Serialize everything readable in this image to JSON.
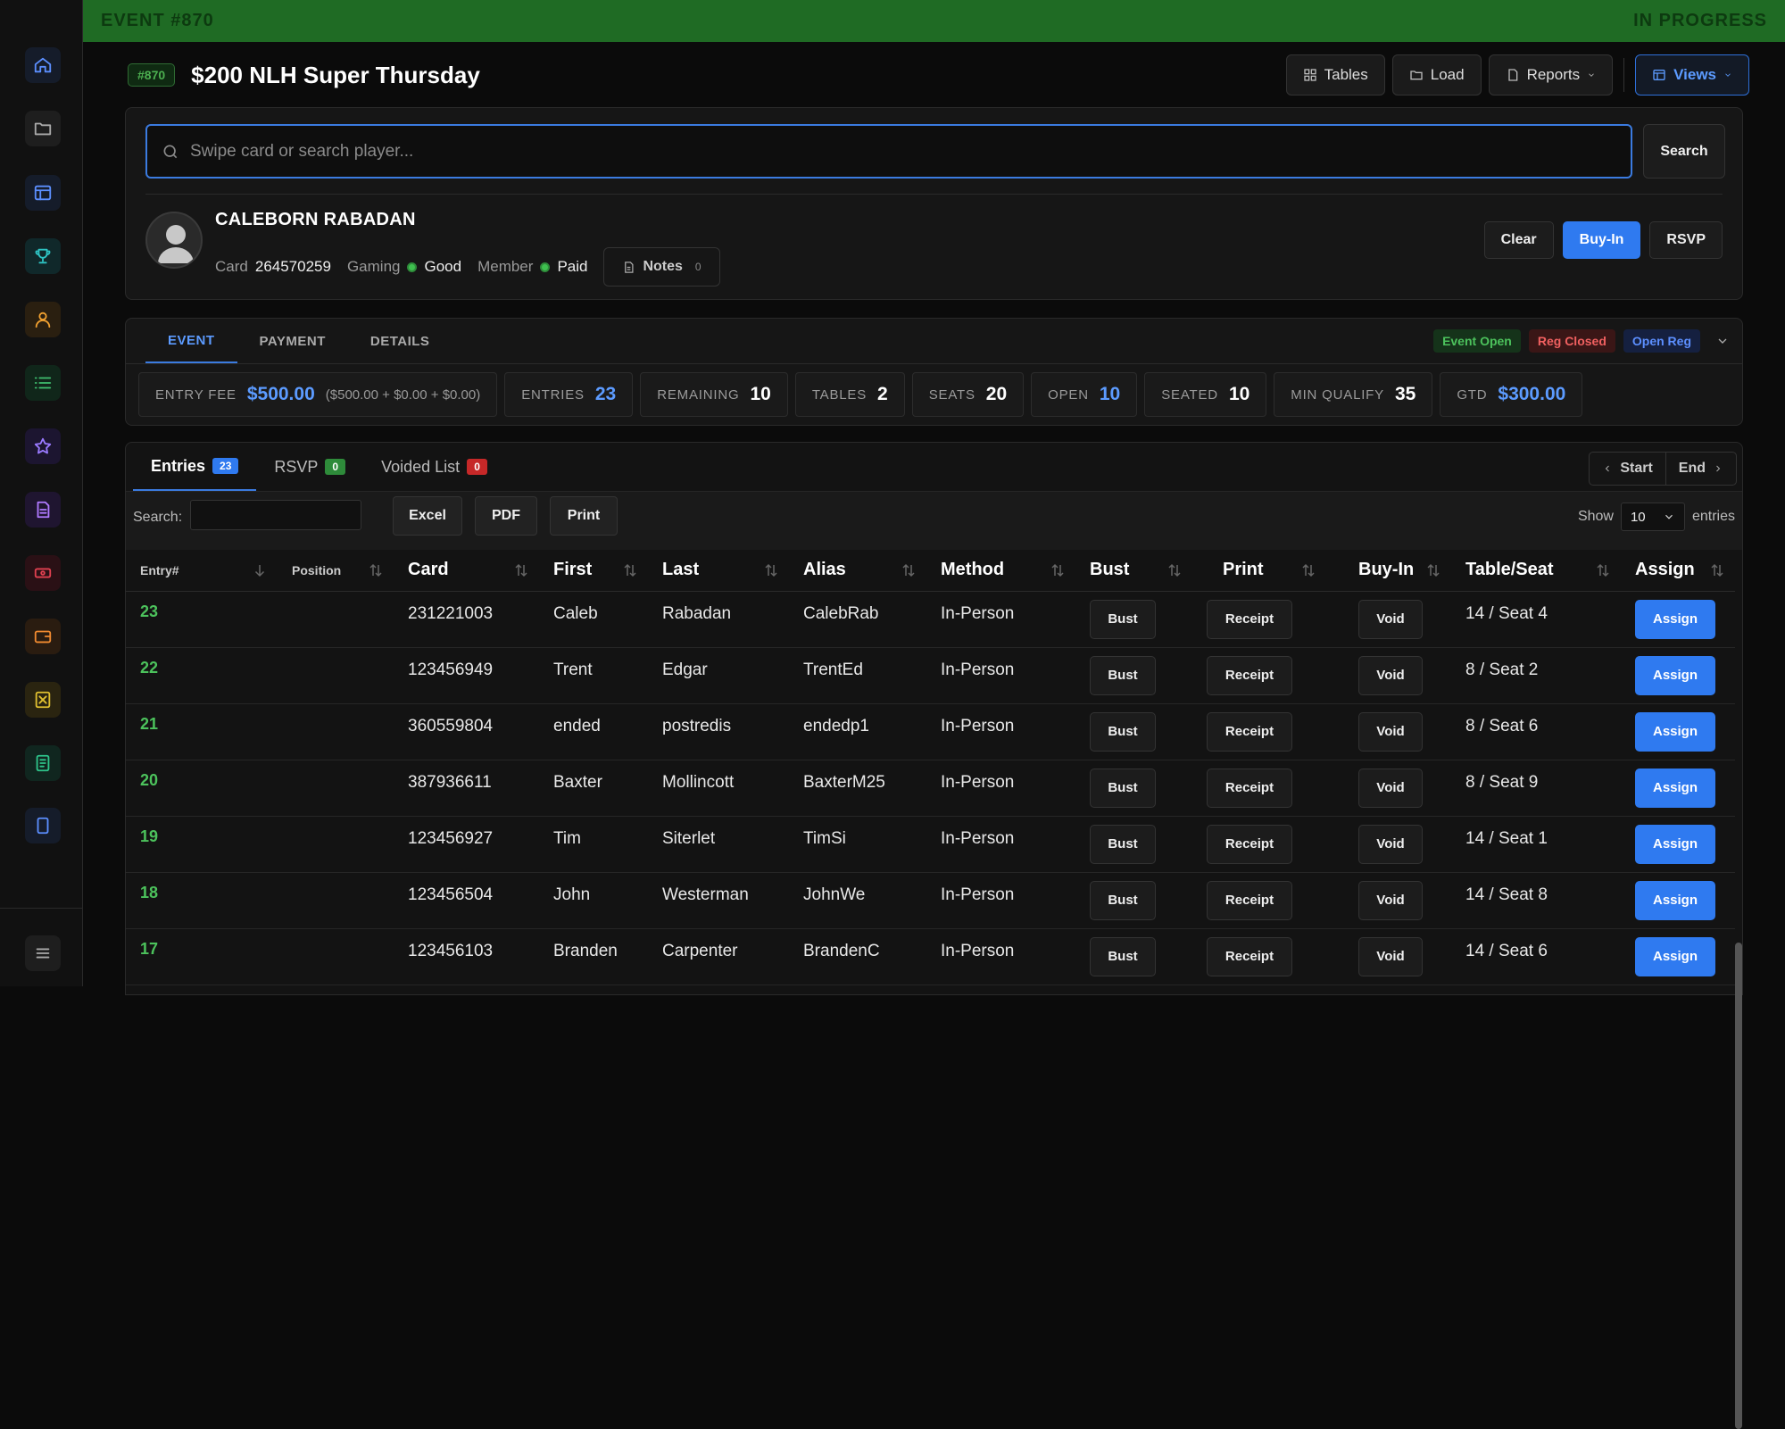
{
  "banner": {
    "event": "EVENT #870",
    "status": "IN PROGRESS"
  },
  "event": {
    "id_badge": "#870",
    "title": "$200 NLH Super Thursday"
  },
  "toolbar": {
    "tables": "Tables",
    "load": "Load",
    "reports": "Reports",
    "views": "Views"
  },
  "search": {
    "placeholder": "Swipe card or search player...",
    "button": "Search"
  },
  "player": {
    "name": "CALEBORN RABADAN",
    "card_label": "Card",
    "card": "264570259",
    "gaming_label": "Gaming",
    "gaming": "Good",
    "member_label": "Member",
    "member": "Paid",
    "notes_label": "Notes",
    "notes_count": "0"
  },
  "player_actions": {
    "clear": "Clear",
    "buyin": "Buy-In",
    "rsvp": "RSVP"
  },
  "event_tabs": [
    "EVENT",
    "PAYMENT",
    "DETAILS"
  ],
  "status_badges": {
    "event_open": "Event Open",
    "reg_closed": "Reg Closed",
    "open_reg": "Open Reg"
  },
  "stats": {
    "entry_fee_label": "ENTRY FEE",
    "entry_fee": "$500.00",
    "entry_fee_breakdown": "($500.00 + $0.00 + $0.00)",
    "entries_label": "ENTRIES",
    "entries": "23",
    "remaining_label": "REMAINING",
    "remaining": "10",
    "tables_label": "TABLES",
    "tables": "2",
    "seats_label": "SEATS",
    "seats": "20",
    "open_label": "OPEN",
    "open": "10",
    "seated_label": "SEATED",
    "seated": "10",
    "min_qualify_label": "MIN QUALIFY",
    "min_qualify": "35",
    "gtd_label": "GTD",
    "gtd": "$300.00"
  },
  "list_tabs": {
    "entries": "Entries",
    "entries_count": "23",
    "rsvp": "RSVP",
    "rsvp_count": "0",
    "voided": "Voided List",
    "voided_count": "0"
  },
  "nav": {
    "start": "Start",
    "end": "End"
  },
  "table_toolbar": {
    "search_label": "Search:",
    "excel": "Excel",
    "pdf": "PDF",
    "print": "Print",
    "show": "Show",
    "show_value": "10",
    "entries": "entries"
  },
  "columns": {
    "entry": "Entry#",
    "position": "Position",
    "card": "Card",
    "first": "First",
    "last": "Last",
    "alias": "Alias",
    "method": "Method",
    "bust": "Bust",
    "print": "Print",
    "buyin": "Buy-In",
    "table_seat": "Table/Seat",
    "assign": "Assign"
  },
  "row_buttons": {
    "bust": "Bust",
    "receipt": "Receipt",
    "void": "Void",
    "assign": "Assign"
  },
  "rows": [
    {
      "entry": "23",
      "card": "231221003",
      "first": "Caleb",
      "last": "Rabadan",
      "alias": "CalebRab",
      "method": "In-Person",
      "seat": "14 / Seat 4"
    },
    {
      "entry": "22",
      "card": "123456949",
      "first": "Trent",
      "last": "Edgar",
      "alias": "TrentEd",
      "method": "In-Person",
      "seat": "8 / Seat 2"
    },
    {
      "entry": "21",
      "card": "360559804",
      "first": "ended",
      "last": "postredis",
      "alias": "endedp1",
      "method": "In-Person",
      "seat": "8 / Seat 6"
    },
    {
      "entry": "20",
      "card": "387936611",
      "first": "Baxter",
      "last": "Mollincott",
      "alias": "BaxterM25",
      "method": "In-Person",
      "seat": "8 / Seat 9"
    },
    {
      "entry": "19",
      "card": "123456927",
      "first": "Tim",
      "last": "Siterlet",
      "alias": "TimSi",
      "method": "In-Person",
      "seat": "14 / Seat 1"
    },
    {
      "entry": "18",
      "card": "123456504",
      "first": "John",
      "last": "Westerman",
      "alias": "JohnWe",
      "method": "In-Person",
      "seat": "14 / Seat 8"
    },
    {
      "entry": "17",
      "card": "123456103",
      "first": "Branden",
      "last": "Carpenter",
      "alias": "BrandenC",
      "method": "In-Person",
      "seat": "14 / Seat 6"
    }
  ],
  "colors": {
    "banner": "#1f6b24",
    "accent": "#2f7af0",
    "success": "#4cc25c",
    "danger": "#c62828"
  }
}
